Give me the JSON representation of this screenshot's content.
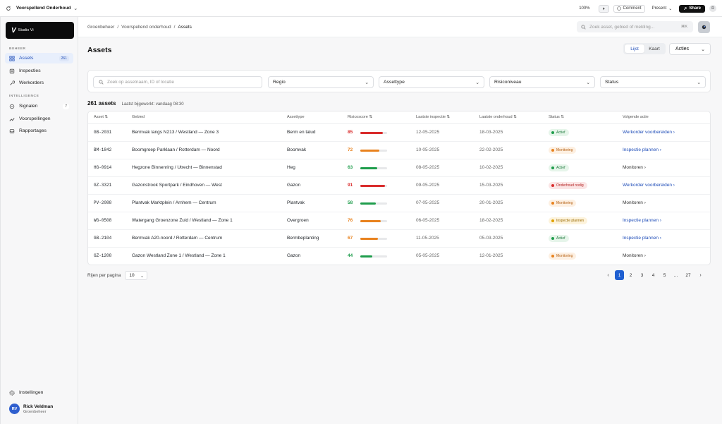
{
  "topbar": {
    "document_title": "Voorspellend Onderhoud",
    "zoom": "100%",
    "comment_label": "Comment",
    "present_label": "Present",
    "share_label": "Share",
    "user_initial": "R"
  },
  "sidebar": {
    "logo_text": "Studio Vi",
    "sections": [
      {
        "label": "BEHEER"
      },
      {
        "label": "INTELLIGENCE"
      }
    ],
    "items": [
      {
        "label": "Assets",
        "icon": "grid-icon",
        "count": "261",
        "active": true
      },
      {
        "label": "Inspecties",
        "icon": "clipboard-icon"
      },
      {
        "label": "Werkorders",
        "icon": "wrench-icon"
      },
      {
        "label": "Signalen",
        "icon": "signal-icon",
        "count": "7"
      },
      {
        "label": "Voorspellingen",
        "icon": "trend-icon"
      },
      {
        "label": "Rapportages",
        "icon": "inbox-icon"
      },
      {
        "label": "Instellingen",
        "icon": "gear-icon"
      }
    ],
    "user": {
      "initials": "RV",
      "name": "Rick Veldman",
      "role": "Groenbeheer"
    }
  },
  "header": {
    "breadcrumb": [
      "Groenbeheer",
      "/",
      "Voorspellend onderhoud",
      "/",
      "Assets"
    ],
    "search_placeholder": "Zoek asset, gebied of melding...",
    "search_shortcut": "⌘K"
  },
  "page": {
    "title": "Assets",
    "views": [
      "Lijst",
      "Kaart"
    ],
    "actions_label": "Acties"
  },
  "filters": {
    "search_placeholder": "Zoek op assetnaam, ID of locatie",
    "selects": [
      "Regio",
      "Assettype",
      "Risiconiveau",
      "Status"
    ]
  },
  "summary": {
    "count": "261 assets",
    "updated": "Laatst bijgewerkt: vandaag 08:30"
  },
  "table": {
    "columns": [
      "Asset",
      "Gebied",
      "Assettype",
      "Risicoscore",
      "Laatste inspectie",
      "Laatste onderhoud",
      "Status",
      "Volgende actie"
    ],
    "rows": [
      {
        "id": "GB-2031",
        "area": "Bermvak langs N213 / Westland — Zone 3",
        "type": "Berm en talud",
        "score": "85",
        "inspection": "12-05-2025",
        "maintenance": "18-03-2025",
        "status": "Actief",
        "action": "Werkorder voorbereiden"
      },
      {
        "id": "BM-1842",
        "area": "Boomgroep Parklaan / Rotterdam — Noord",
        "type": "Boomvak",
        "score": "72",
        "inspection": "10-05-2025",
        "maintenance": "22-02-2025",
        "status": "Monitoring",
        "action": "Inspectie plannen"
      },
      {
        "id": "HG-0914",
        "area": "Hegzone Binnenring / Utrecht — Binnenstad",
        "type": "Heg",
        "score": "63",
        "inspection": "08-05-2025",
        "maintenance": "10-02-2025",
        "status": "Actief",
        "action": "Monitoren"
      },
      {
        "id": "GZ-3321",
        "area": "Gazonstrook Sportpark / Eindhoven — West",
        "type": "Gazon",
        "score": "91",
        "inspection": "09-05-2025",
        "maintenance": "15-03-2025",
        "status": "Onderhoud nodig",
        "action": "Werkorder voorbereiden"
      },
      {
        "id": "PV-2088",
        "area": "Plantvak Marktplein / Arnhem — Centrum",
        "type": "Plantvak",
        "score": "58",
        "inspection": "07-05-2025",
        "maintenance": "20-01-2025",
        "status": "Monitoring",
        "action": "Monitoren"
      },
      {
        "id": "WG-0508",
        "area": "Watergang Groenzone Zuid / Westland — Zone 1",
        "type": "Overgroen",
        "score": "76",
        "inspection": "06-05-2025",
        "maintenance": "18-02-2025",
        "status": "Inspectie plannen",
        "action": "Inspectie plannen"
      },
      {
        "id": "GB-2104",
        "area": "Bermvak A20-noord / Rotterdam — Centrum",
        "type": "Bermbeplanting",
        "score": "67",
        "inspection": "11-05-2025",
        "maintenance": "05-03-2025",
        "status": "Actief",
        "action": "Inspectie plannen"
      },
      {
        "id": "GZ-1208",
        "area": "Gazon Westland Zone 1 / Westland — Zone 1",
        "type": "Gazon",
        "score": "44",
        "inspection": "05-05-2025",
        "maintenance": "12-01-2025",
        "status": "Monitoring",
        "action": "Monitoren"
      }
    ]
  },
  "pagination": {
    "rows_label": "Rijen per pagina",
    "rows_value": "10",
    "pages": [
      "1",
      "2",
      "3",
      "4",
      "5",
      "…",
      "27"
    ],
    "current": "1"
  },
  "colors": {
    "accent": "#1f5fd1",
    "high": "#d92c2c",
    "medium": "#e8821e",
    "low": "#1f9d4c"
  }
}
